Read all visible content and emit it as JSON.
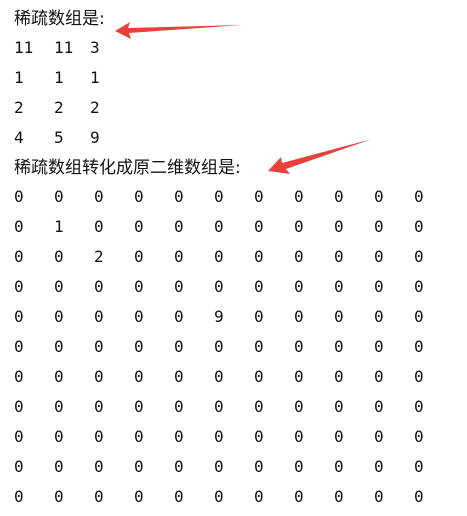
{
  "console": {
    "sparse_heading": "稀疏数组是:",
    "sparse_rows": [
      [
        "11",
        "11",
        "3"
      ],
      [
        "1",
        "1",
        "1"
      ],
      [
        "2",
        "2",
        "2"
      ],
      [
        "4",
        "5",
        "9"
      ]
    ],
    "restored_heading": "稀疏数组转化成原二维数组是:",
    "restored_rows": [
      [
        "0",
        "0",
        "0",
        "0",
        "0",
        "0",
        "0",
        "0",
        "0",
        "0",
        "0"
      ],
      [
        "0",
        "1",
        "0",
        "0",
        "0",
        "0",
        "0",
        "0",
        "0",
        "0",
        "0"
      ],
      [
        "0",
        "0",
        "2",
        "0",
        "0",
        "0",
        "0",
        "0",
        "0",
        "0",
        "0"
      ],
      [
        "0",
        "0",
        "0",
        "0",
        "0",
        "0",
        "0",
        "0",
        "0",
        "0",
        "0"
      ],
      [
        "0",
        "0",
        "0",
        "0",
        "0",
        "9",
        "0",
        "0",
        "0",
        "0",
        "0"
      ],
      [
        "0",
        "0",
        "0",
        "0",
        "0",
        "0",
        "0",
        "0",
        "0",
        "0",
        "0"
      ],
      [
        "0",
        "0",
        "0",
        "0",
        "0",
        "0",
        "0",
        "0",
        "0",
        "0",
        "0"
      ],
      [
        "0",
        "0",
        "0",
        "0",
        "0",
        "0",
        "0",
        "0",
        "0",
        "0",
        "0"
      ],
      [
        "0",
        "0",
        "0",
        "0",
        "0",
        "0",
        "0",
        "0",
        "0",
        "0",
        "0"
      ],
      [
        "0",
        "0",
        "0",
        "0",
        "0",
        "0",
        "0",
        "0",
        "0",
        "0",
        "0"
      ],
      [
        "0",
        "0",
        "0",
        "0",
        "0",
        "0",
        "0",
        "0",
        "0",
        "0",
        "0"
      ]
    ]
  },
  "colors": {
    "annotation_arrow": "#e8403a"
  },
  "icons": [
    "annotation-arrow-icon"
  ]
}
